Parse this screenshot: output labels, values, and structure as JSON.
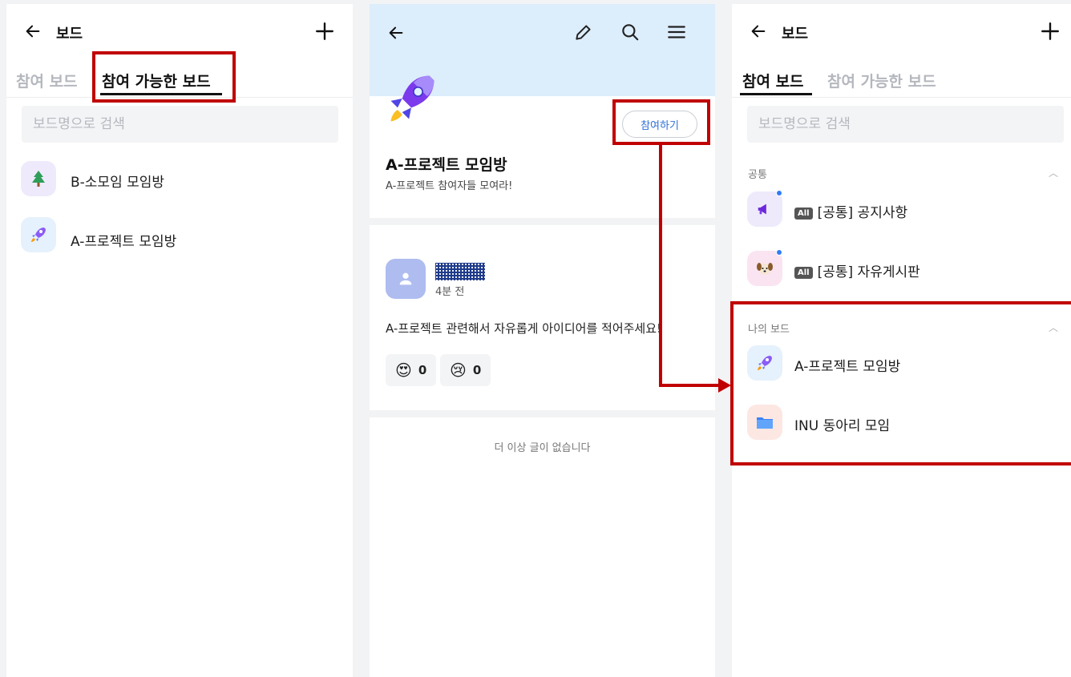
{
  "left_screen": {
    "header_title": "보드",
    "tabs": [
      {
        "label": "참여 보드",
        "active": false
      },
      {
        "label": "참여 가능한 보드",
        "active": true
      }
    ],
    "search": {
      "placeholder": "보드명으로 검색",
      "value": ""
    },
    "boards": [
      {
        "icon": "tree-icon",
        "label": "B-소모임 모임방"
      },
      {
        "icon": "rocket-icon",
        "label": "A-프로젝트 모임방"
      }
    ]
  },
  "middle_screen": {
    "board_title": "A-프로젝트 모임방",
    "board_desc": "A-프로젝트 참여자들 모여라!",
    "join_label": "참여하기",
    "post": {
      "time": "4분 전",
      "body": "A-프로젝트 관련해서 자유롭게 아이디어를 적어주세요!",
      "reactions": [
        {
          "emoji": "😍",
          "count": "0"
        },
        {
          "emoji": "😢",
          "count": "0"
        }
      ]
    },
    "no_more_text": "더 이상 글이 없습니다"
  },
  "right_screen": {
    "header_title": "보드",
    "tabs": [
      {
        "label": "참여 보드",
        "active": true
      },
      {
        "label": "참여 가능한 보드",
        "active": false
      }
    ],
    "search": {
      "placeholder": "보드명으로 검색",
      "value": ""
    },
    "common_section": {
      "label": "공통",
      "items": [
        {
          "icon": "megaphone-icon",
          "badge": "All",
          "label": "[공통] 공지사항"
        },
        {
          "icon": "puppy-icon",
          "badge": "All",
          "label": "[공통] 자유게시판"
        }
      ]
    },
    "my_section": {
      "label": "나의 보드",
      "items": [
        {
          "icon": "rocket-icon",
          "label": "A-프로젝트 모임방"
        },
        {
          "icon": "folder-icon",
          "label": "INU 동아리 모임"
        }
      ]
    }
  },
  "colors": {
    "highlight": "#c00000",
    "cover": "#dcedfc",
    "join_text": "#2d6fd6",
    "notification_dot": "#2f7cf6"
  }
}
